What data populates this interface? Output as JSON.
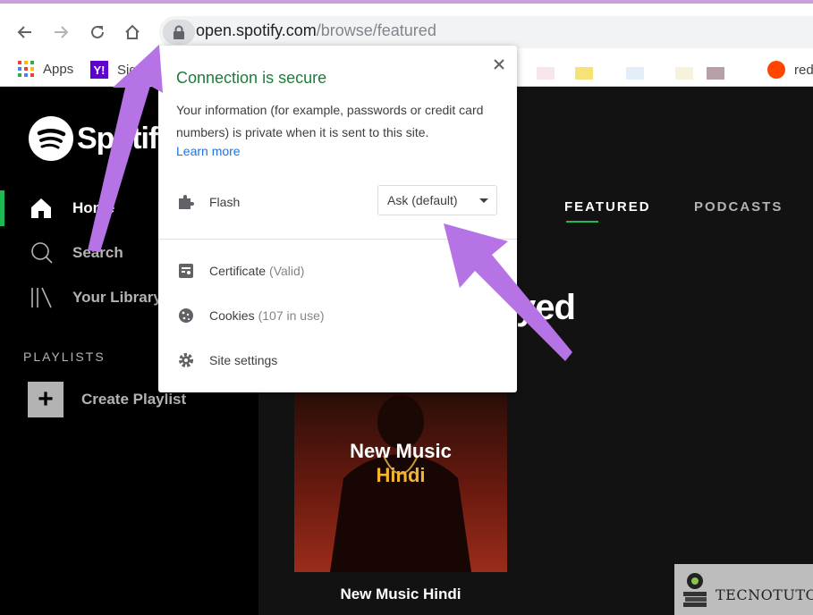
{
  "browser": {
    "url_host": "open.spotify.com",
    "url_path": "/browse/featured",
    "bookmarks": [
      {
        "label": "Apps",
        "icon": "apps-grid-icon"
      },
      {
        "label": "Sign",
        "icon": "yahoo-icon"
      },
      {
        "label": "red",
        "icon": "reddit-icon"
      }
    ]
  },
  "sidebar": {
    "logo_text": "Spotify",
    "nav": [
      {
        "label": "Home",
        "icon": "home-icon",
        "active": true
      },
      {
        "label": "Search",
        "icon": "search-icon",
        "active": false
      },
      {
        "label": "Your Library",
        "icon": "library-icon",
        "active": false
      }
    ],
    "playlists_label": "PLAYLISTS",
    "create_playlist": "Create Playlist"
  },
  "main": {
    "tabs": [
      {
        "label": "FEATURED",
        "active": true
      },
      {
        "label": "PODCASTS",
        "active": false
      }
    ],
    "headline_partial": "yed",
    "album": {
      "title_line1": "New Music",
      "title_line2": "Hindi",
      "caption": "New Music Hindi"
    }
  },
  "popup": {
    "title": "Connection is secure",
    "description": "Your information (for example, passwords or credit card numbers) is private when it is sent to this site.",
    "learn_more": "Learn more",
    "flash_label": "Flash",
    "flash_value": "Ask (default)",
    "certificate_label": "Certificate",
    "certificate_status": "(Valid)",
    "cookies_label": "Cookies",
    "cookies_status": "(107 in use)",
    "site_settings_label": "Site settings"
  },
  "watermark": {
    "text": "TECNOTUTO"
  },
  "colors": {
    "spotify_green": "#1db954",
    "secure_green": "#188038",
    "link_blue": "#1a73e8",
    "arrow_purple": "#b673e6"
  }
}
